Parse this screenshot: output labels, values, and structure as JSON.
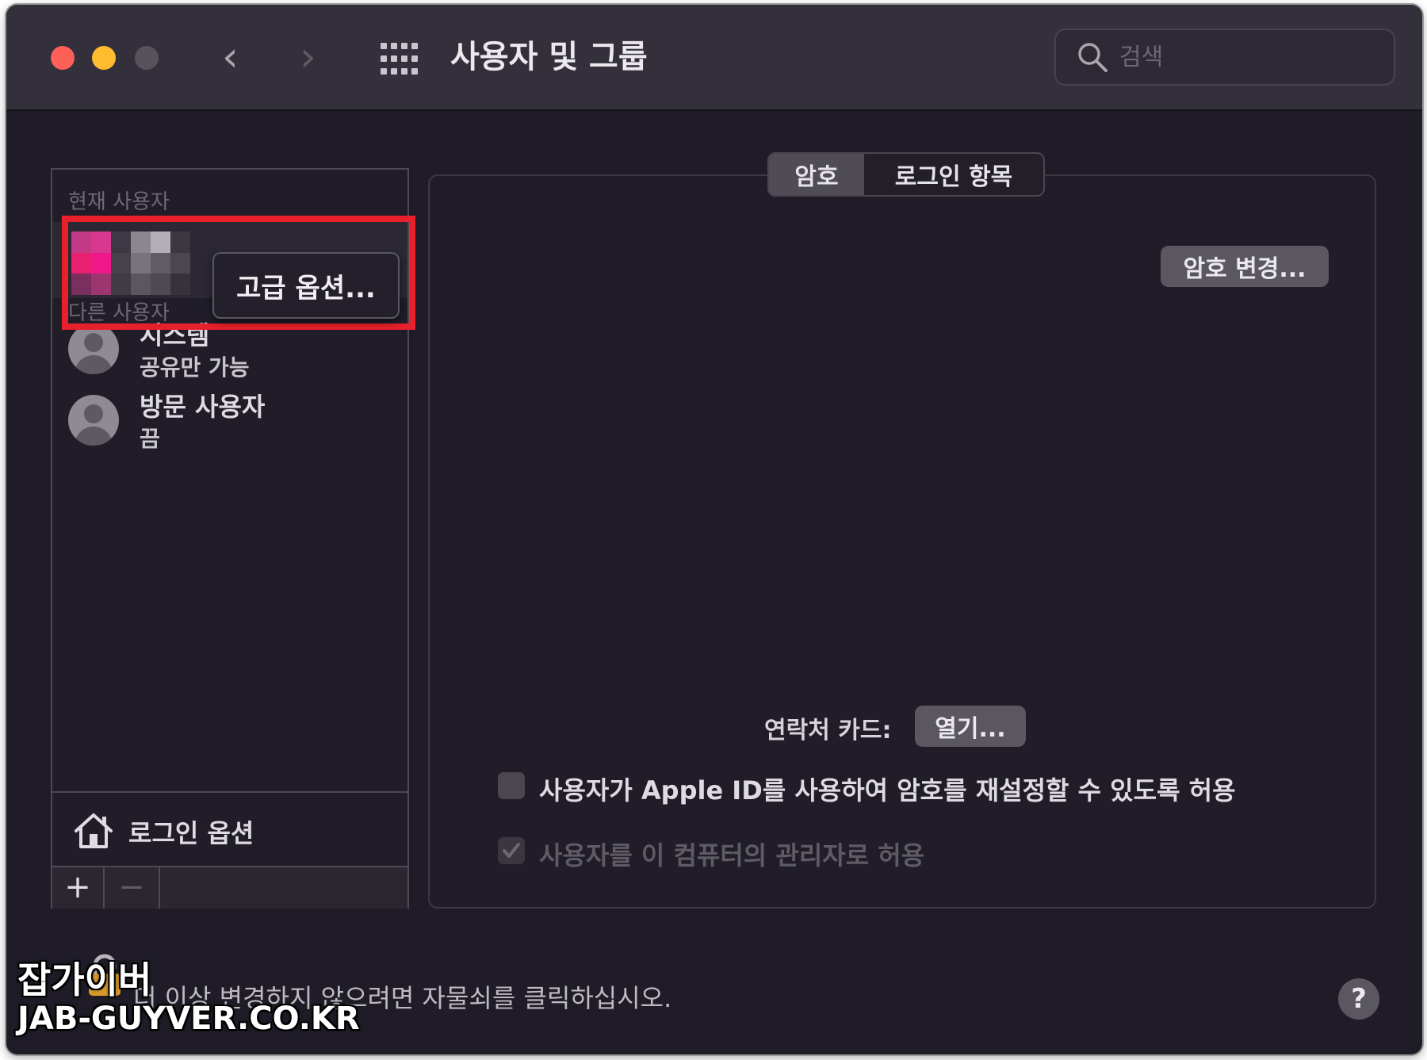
{
  "window": {
    "title": "사용자 및 그룹",
    "search_placeholder": "검색",
    "nav_back": "‹",
    "nav_forward": "›"
  },
  "sidebar": {
    "current_user_header": "현재 사용자",
    "other_users_header": "다른 사용자",
    "context_menu_item": "고급 옵션...",
    "users": [
      {
        "name": "시스템",
        "status": "공유만 가능"
      },
      {
        "name": "방문 사용자",
        "status": "끔"
      }
    ],
    "login_options": "로그인 옵션",
    "add": "+",
    "remove": "−"
  },
  "tabs": [
    "암호",
    "로그인 항목"
  ],
  "main": {
    "change_password_button": "암호 변경...",
    "contact_card_label": "연락처 카드:",
    "open_button": "열기...",
    "allow_apple_id_reset": "사용자가 Apple ID를 사용하여 암호를 재설정할 수 있도록 허용",
    "allow_admin": "사용자를 이 컴퓨터의 관리자로 허용",
    "allow_apple_id_reset_checked": false,
    "allow_admin_checked": true
  },
  "footer": {
    "lock_text": "더 이상 변경하지 않으려면 자물쇠를 클릭하십시오.",
    "help": "?"
  },
  "watermark": {
    "line1": "잡가이버",
    "line2": "JAB-GUYVER.CO.KR"
  },
  "colors": {
    "highlight_box": "#e8202c",
    "window_bg": "#1f1c27",
    "titlebar_bg": "#34303b"
  }
}
